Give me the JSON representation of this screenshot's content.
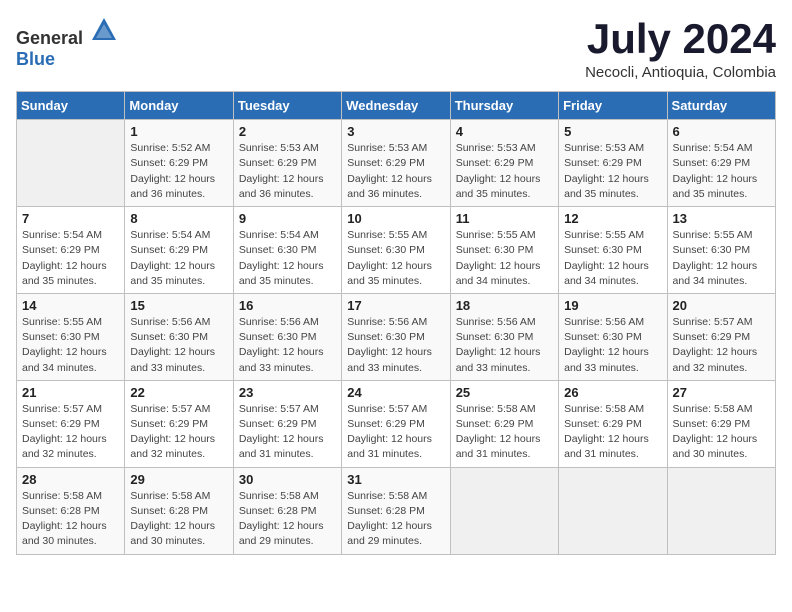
{
  "header": {
    "logo": {
      "text_general": "General",
      "text_blue": "Blue"
    },
    "title": "July 2024",
    "location": "Necocli, Antioquia, Colombia"
  },
  "calendar": {
    "days_of_week": [
      "Sunday",
      "Monday",
      "Tuesday",
      "Wednesday",
      "Thursday",
      "Friday",
      "Saturday"
    ],
    "weeks": [
      [
        {
          "day": "",
          "info": ""
        },
        {
          "day": "1",
          "info": "Sunrise: 5:52 AM\nSunset: 6:29 PM\nDaylight: 12 hours\nand 36 minutes."
        },
        {
          "day": "2",
          "info": "Sunrise: 5:53 AM\nSunset: 6:29 PM\nDaylight: 12 hours\nand 36 minutes."
        },
        {
          "day": "3",
          "info": "Sunrise: 5:53 AM\nSunset: 6:29 PM\nDaylight: 12 hours\nand 36 minutes."
        },
        {
          "day": "4",
          "info": "Sunrise: 5:53 AM\nSunset: 6:29 PM\nDaylight: 12 hours\nand 35 minutes."
        },
        {
          "day": "5",
          "info": "Sunrise: 5:53 AM\nSunset: 6:29 PM\nDaylight: 12 hours\nand 35 minutes."
        },
        {
          "day": "6",
          "info": "Sunrise: 5:54 AM\nSunset: 6:29 PM\nDaylight: 12 hours\nand 35 minutes."
        }
      ],
      [
        {
          "day": "7",
          "info": "Sunrise: 5:54 AM\nSunset: 6:29 PM\nDaylight: 12 hours\nand 35 minutes."
        },
        {
          "day": "8",
          "info": "Sunrise: 5:54 AM\nSunset: 6:29 PM\nDaylight: 12 hours\nand 35 minutes."
        },
        {
          "day": "9",
          "info": "Sunrise: 5:54 AM\nSunset: 6:30 PM\nDaylight: 12 hours\nand 35 minutes."
        },
        {
          "day": "10",
          "info": "Sunrise: 5:55 AM\nSunset: 6:30 PM\nDaylight: 12 hours\nand 35 minutes."
        },
        {
          "day": "11",
          "info": "Sunrise: 5:55 AM\nSunset: 6:30 PM\nDaylight: 12 hours\nand 34 minutes."
        },
        {
          "day": "12",
          "info": "Sunrise: 5:55 AM\nSunset: 6:30 PM\nDaylight: 12 hours\nand 34 minutes."
        },
        {
          "day": "13",
          "info": "Sunrise: 5:55 AM\nSunset: 6:30 PM\nDaylight: 12 hours\nand 34 minutes."
        }
      ],
      [
        {
          "day": "14",
          "info": "Sunrise: 5:55 AM\nSunset: 6:30 PM\nDaylight: 12 hours\nand 34 minutes."
        },
        {
          "day": "15",
          "info": "Sunrise: 5:56 AM\nSunset: 6:30 PM\nDaylight: 12 hours\nand 33 minutes."
        },
        {
          "day": "16",
          "info": "Sunrise: 5:56 AM\nSunset: 6:30 PM\nDaylight: 12 hours\nand 33 minutes."
        },
        {
          "day": "17",
          "info": "Sunrise: 5:56 AM\nSunset: 6:30 PM\nDaylight: 12 hours\nand 33 minutes."
        },
        {
          "day": "18",
          "info": "Sunrise: 5:56 AM\nSunset: 6:30 PM\nDaylight: 12 hours\nand 33 minutes."
        },
        {
          "day": "19",
          "info": "Sunrise: 5:56 AM\nSunset: 6:30 PM\nDaylight: 12 hours\nand 33 minutes."
        },
        {
          "day": "20",
          "info": "Sunrise: 5:57 AM\nSunset: 6:29 PM\nDaylight: 12 hours\nand 32 minutes."
        }
      ],
      [
        {
          "day": "21",
          "info": "Sunrise: 5:57 AM\nSunset: 6:29 PM\nDaylight: 12 hours\nand 32 minutes."
        },
        {
          "day": "22",
          "info": "Sunrise: 5:57 AM\nSunset: 6:29 PM\nDaylight: 12 hours\nand 32 minutes."
        },
        {
          "day": "23",
          "info": "Sunrise: 5:57 AM\nSunset: 6:29 PM\nDaylight: 12 hours\nand 31 minutes."
        },
        {
          "day": "24",
          "info": "Sunrise: 5:57 AM\nSunset: 6:29 PM\nDaylight: 12 hours\nand 31 minutes."
        },
        {
          "day": "25",
          "info": "Sunrise: 5:58 AM\nSunset: 6:29 PM\nDaylight: 12 hours\nand 31 minutes."
        },
        {
          "day": "26",
          "info": "Sunrise: 5:58 AM\nSunset: 6:29 PM\nDaylight: 12 hours\nand 31 minutes."
        },
        {
          "day": "27",
          "info": "Sunrise: 5:58 AM\nSunset: 6:29 PM\nDaylight: 12 hours\nand 30 minutes."
        }
      ],
      [
        {
          "day": "28",
          "info": "Sunrise: 5:58 AM\nSunset: 6:28 PM\nDaylight: 12 hours\nand 30 minutes."
        },
        {
          "day": "29",
          "info": "Sunrise: 5:58 AM\nSunset: 6:28 PM\nDaylight: 12 hours\nand 30 minutes."
        },
        {
          "day": "30",
          "info": "Sunrise: 5:58 AM\nSunset: 6:28 PM\nDaylight: 12 hours\nand 29 minutes."
        },
        {
          "day": "31",
          "info": "Sunrise: 5:58 AM\nSunset: 6:28 PM\nDaylight: 12 hours\nand 29 minutes."
        },
        {
          "day": "",
          "info": ""
        },
        {
          "day": "",
          "info": ""
        },
        {
          "day": "",
          "info": ""
        }
      ]
    ]
  }
}
